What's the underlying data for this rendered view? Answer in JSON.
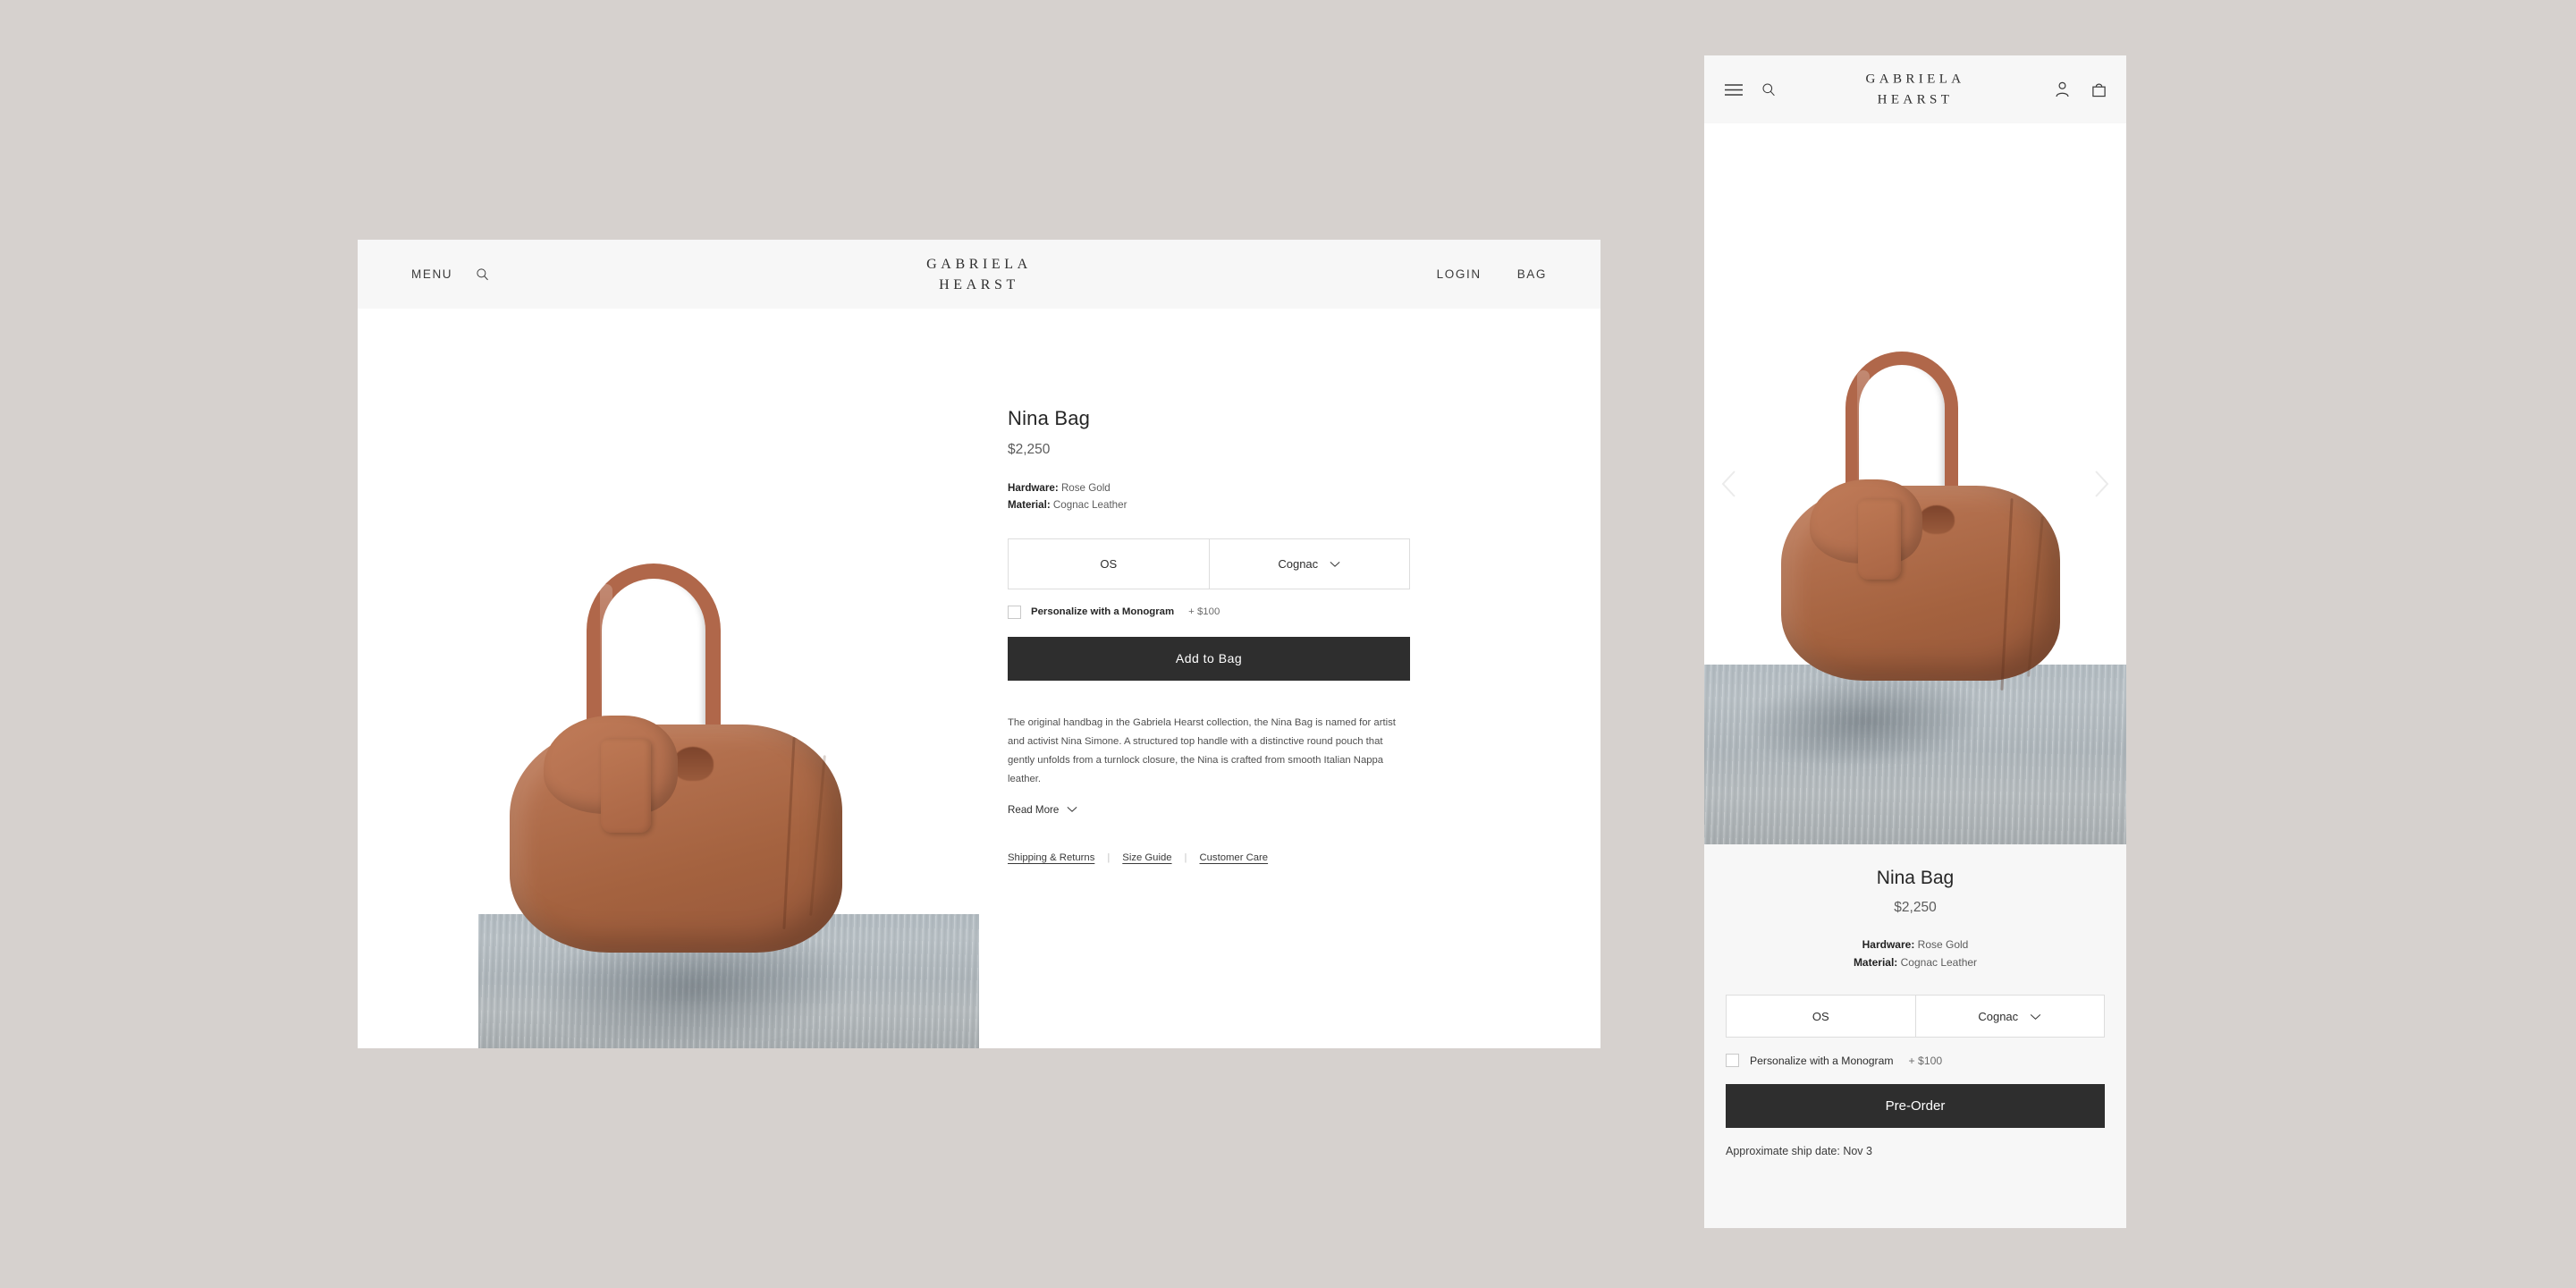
{
  "desktop": {
    "header": {
      "menu_label": "MENU",
      "search_icon": "search-icon",
      "logo_line1": "GABRIELA",
      "logo_line2": "HEARST",
      "login_label": "LOGIN",
      "bag_label": "BAG"
    },
    "product": {
      "title": "Nina Bag",
      "price": "$2,250",
      "hardware_label": "Hardware:",
      "hardware_value": "Rose Gold",
      "material_label": "Material:",
      "material_value": "Cognac Leather",
      "size_value": "OS",
      "color_value": "Cognac",
      "color_chevron": "chevron-down-icon",
      "monogram_label": "Personalize with a Monogram",
      "monogram_price": "+ $100",
      "cta_label": "Add  to Bag",
      "description": "The original handbag in the Gabriela Hearst collection, the Nina Bag is named for artist and activist Nina Simone. A structured top handle with a distinctive round pouch that gently unfolds from a turnlock closure, the Nina is crafted from smooth Italian Nappa leather.",
      "read_more_label": "Read More",
      "read_more_chevron": "chevron-down-icon",
      "links": [
        {
          "label": "Shipping & Returns"
        },
        {
          "label": "Size Guide"
        },
        {
          "label": "Customer Care"
        }
      ],
      "link_divider": "|"
    }
  },
  "mobile": {
    "header": {
      "menu_icon": "hamburger-menu-icon",
      "search_icon": "search-icon",
      "logo_line1": "GABRIELA",
      "logo_line2": "HEARST",
      "account_icon": "user-account-icon",
      "bag_icon": "shopping-bag-icon"
    },
    "carousel": {
      "prev_icon": "chevron-left-icon",
      "next_icon": "chevron-right-icon"
    },
    "product": {
      "title": "Nina Bag",
      "price": "$2,250",
      "hardware_label": "Hardware:",
      "hardware_value": "Rose Gold",
      "material_label": "Material:",
      "material_value": "Cognac Leather",
      "size_value": "OS",
      "color_value": "Cognac",
      "color_chevron": "chevron-down-icon",
      "monogram_label": "Personalize with a Monogram",
      "monogram_price": "+ $100",
      "cta_label": "Pre-Order",
      "ship_date": "Approximate ship date: Nov 3"
    }
  },
  "colors": {
    "page_background": "#d6d1ce",
    "panel_background": "#ffffff",
    "header_background": "#f7f7f7",
    "cta_background": "#2e2e2e",
    "leather_brown": "#b06a49"
  }
}
